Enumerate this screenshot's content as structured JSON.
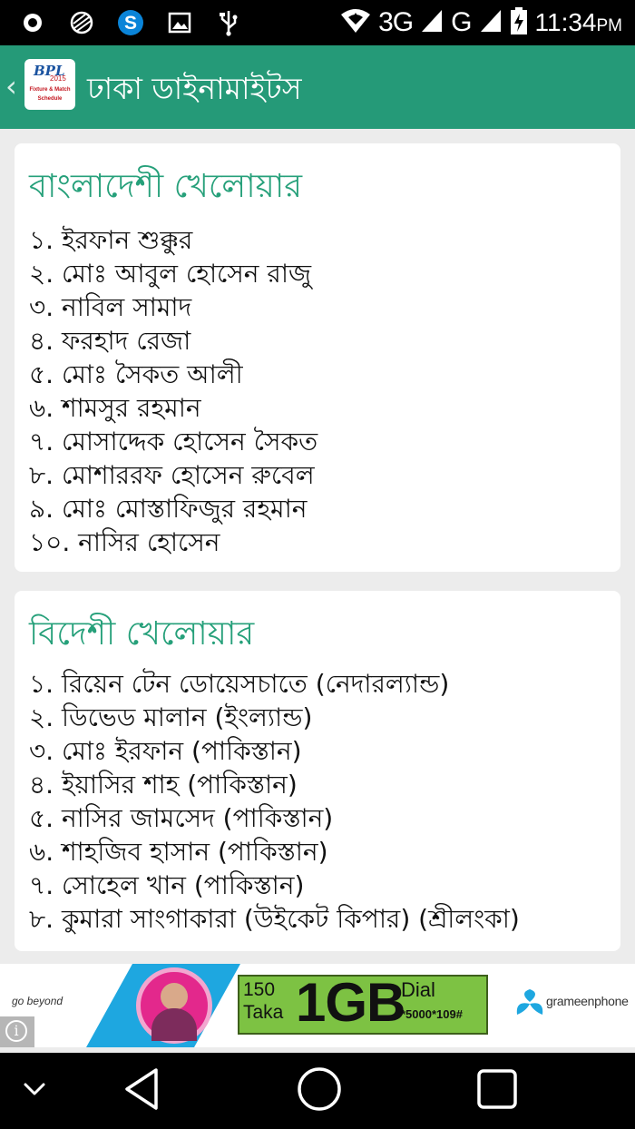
{
  "status_bar": {
    "network_3g": "3G",
    "network_g": "G",
    "time": "11:34",
    "ampm": "PM"
  },
  "app_bar": {
    "title": "ঢাকা ডাইনামাইটস",
    "logo": {
      "text": "BPL",
      "year": "2015",
      "line1": "Fixture & Match",
      "line2": "Schedule"
    }
  },
  "local_players": {
    "title": "বাংলাদেশী খেলোয়ার",
    "items": [
      "১. ইরফান শুক্কুর",
      "২. মোঃ আবুল হোসেন রাজু",
      "৩. নাবিল সামাদ",
      "৪. ফরহাদ রেজা",
      "৫. মোঃ সৈকত আলী",
      "৬. শামসুর রহমান",
      "৭. মোসাদ্দেক হোসেন সৈকত",
      "৮. মোশাররফ হোসেন রুবেল",
      "৯. মোঃ মোস্তাফিজুর রহমান",
      "১০. নাসির হোসেন"
    ]
  },
  "foreign_players": {
    "title": "বিদেশী খেলোয়ার",
    "items": [
      "১. রিয়েন টেন ডোয়েসচাতে (নেদারল্যান্ড)",
      "২. ডিভেড মালান (ইংল্যান্ড)",
      "৩. মোঃ ইরফান (পাকিস্তান)",
      "৪. ইয়াসির শাহ (পাকিস্তান)",
      "৫. নাসির জামসেদ (পাকিস্তান)",
      "৬. শাহজিব হাসান (পাকিস্তান)",
      "৭. সোহেল খান (পাকিস্তান)",
      "৮. কুমারা সাংগাকারা (উইকেট কিপার) (শ্রীলংকা)"
    ]
  },
  "ad": {
    "tagline": "go beyond",
    "price_amount": "150",
    "price_unit": "Taka",
    "data_amount": "1GB",
    "dial_label": "Dial",
    "dial_code": "*5000*109#",
    "brand": "grameenphone",
    "colors": {
      "swoosh": "#1ea7e0",
      "offer": "#7dc243",
      "model_ring": "#e3288c"
    }
  },
  "icons": {
    "status_left": [
      "record-icon",
      "globe-icon",
      "skype-icon",
      "image-icon",
      "usb-icon"
    ],
    "status_right": [
      "wifi-icon",
      "signal-3g-icon",
      "signal-g-icon",
      "battery-charging-icon"
    ],
    "nav": [
      "chevron-down-icon",
      "back-icon",
      "home-icon",
      "recents-icon"
    ]
  },
  "colors": {
    "app_bar": "#259a78",
    "accent_title": "#26a07a",
    "background": "#ececec"
  }
}
